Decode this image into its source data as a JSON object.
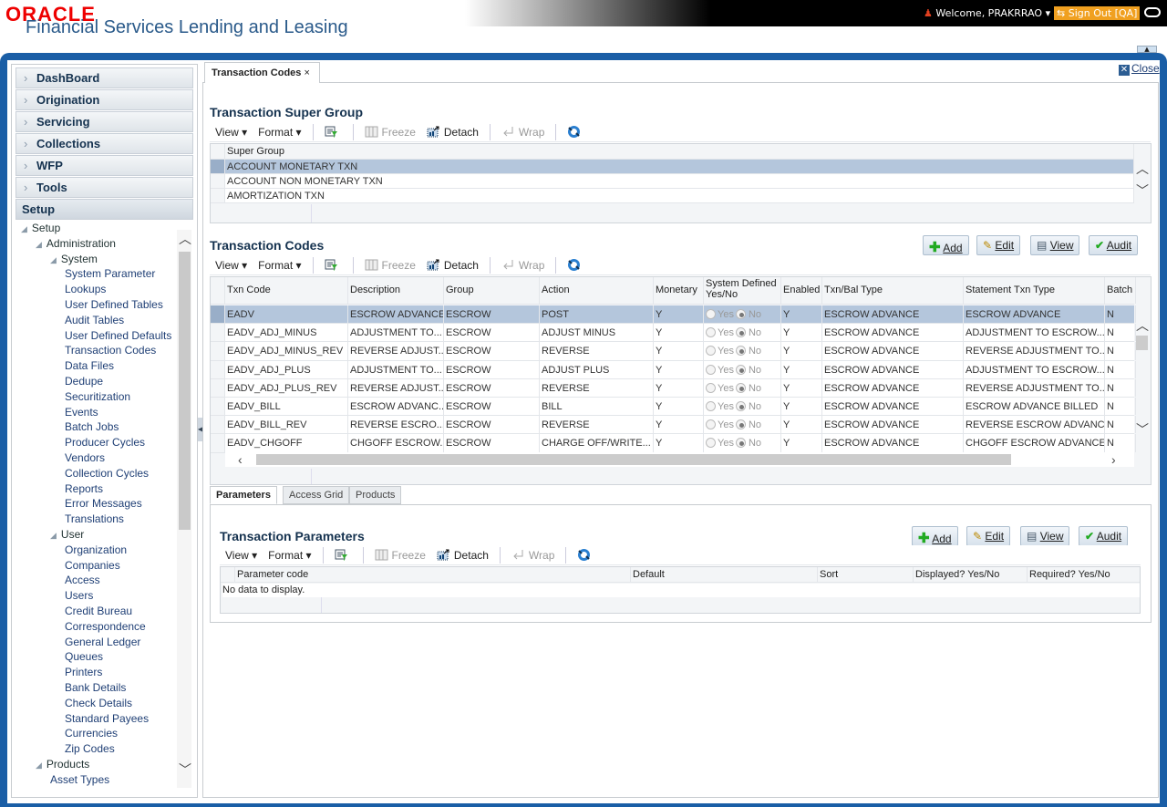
{
  "header": {
    "logo": "ORACLE",
    "app_title": "Financial Services Lending and Leasing",
    "welcome": "Welcome, PRAKRRAO ▾",
    "signout": "Sign Out [QA]"
  },
  "sidebar": {
    "accordion": [
      "DashBoard",
      "Origination",
      "Servicing",
      "Collections",
      "WFP",
      "Tools",
      "Setup"
    ],
    "tree": [
      {
        "label": "Setup",
        "level": 0,
        "node": true
      },
      {
        "label": "Administration",
        "level": 1,
        "node": true
      },
      {
        "label": "System",
        "level": 2,
        "node": true
      },
      {
        "label": "System Parameter",
        "level": 3
      },
      {
        "label": "Lookups",
        "level": 3
      },
      {
        "label": "User Defined Tables",
        "level": 3
      },
      {
        "label": "Audit Tables",
        "level": 3
      },
      {
        "label": "User Defined Defaults",
        "level": 3
      },
      {
        "label": "Transaction Codes",
        "level": 3
      },
      {
        "label": "Data Files",
        "level": 3
      },
      {
        "label": "Dedupe",
        "level": 3
      },
      {
        "label": "Securitization",
        "level": 3
      },
      {
        "label": "Events",
        "level": 3
      },
      {
        "label": "Batch Jobs",
        "level": 3
      },
      {
        "label": "Producer Cycles",
        "level": 3
      },
      {
        "label": "Vendors",
        "level": 3
      },
      {
        "label": "Collection Cycles",
        "level": 3
      },
      {
        "label": "Reports",
        "level": 3
      },
      {
        "label": "Error Messages",
        "level": 3
      },
      {
        "label": "Translations",
        "level": 3
      },
      {
        "label": "User",
        "level": 2,
        "node": true
      },
      {
        "label": "Organization",
        "level": 3
      },
      {
        "label": "Companies",
        "level": 3
      },
      {
        "label": "Access",
        "level": 3
      },
      {
        "label": "Users",
        "level": 3
      },
      {
        "label": "Credit Bureau",
        "level": 3
      },
      {
        "label": "Correspondence",
        "level": 3
      },
      {
        "label": "General Ledger",
        "level": 3
      },
      {
        "label": "Queues",
        "level": 3
      },
      {
        "label": "Printers",
        "level": 3
      },
      {
        "label": "Bank Details",
        "level": 3
      },
      {
        "label": "Check Details",
        "level": 3
      },
      {
        "label": "Standard Payees",
        "level": 3
      },
      {
        "label": "Currencies",
        "level": 3
      },
      {
        "label": "Zip Codes",
        "level": 3
      },
      {
        "label": "Products",
        "level": 1,
        "node": true
      },
      {
        "label": "Asset Types",
        "level": 2
      }
    ]
  },
  "main": {
    "tab": "Transaction Codes",
    "close": "Close",
    "toolbar": {
      "view": "View ▾",
      "format": "Format ▾",
      "freeze": "Freeze",
      "detach": "Detach",
      "wrap": "Wrap"
    },
    "super_group": {
      "title": "Transaction Super Group",
      "header": "Super Group",
      "rows": [
        "ACCOUNT MONETARY TXN",
        "ACCOUNT NON MONETARY TXN",
        "AMORTIZATION TXN"
      ]
    },
    "codes": {
      "title": "Transaction Codes",
      "buttons": {
        "add": "Add",
        "edit": "Edit",
        "view": "View",
        "audit": "Audit"
      },
      "columns": [
        "Txn Code",
        "Description",
        "Group",
        "Action",
        "Monetary",
        "System Defined Yes/No",
        "Enabled",
        "Txn/Bal Type",
        "Statement Txn Type",
        "Batch"
      ],
      "radio_yes": "Yes",
      "radio_no": "No",
      "rows": [
        [
          "EADV",
          "ESCROW ADVANCE",
          "ESCROW",
          "POST",
          "Y",
          "No",
          "Y",
          "ESCROW ADVANCE",
          "ESCROW ADVANCE",
          "N"
        ],
        [
          "EADV_ADJ_MINUS",
          "ADJUSTMENT TO...",
          "ESCROW",
          "ADJUST MINUS",
          "Y",
          "No",
          "Y",
          "ESCROW ADVANCE",
          "ADJUSTMENT TO ESCROW...",
          "N"
        ],
        [
          "EADV_ADJ_MINUS_REV",
          "REVERSE ADJUST...",
          "ESCROW",
          "REVERSE",
          "Y",
          "No",
          "Y",
          "ESCROW ADVANCE",
          "REVERSE ADJUSTMENT TO...",
          "N"
        ],
        [
          "EADV_ADJ_PLUS",
          "ADJUSTMENT TO...",
          "ESCROW",
          "ADJUST PLUS",
          "Y",
          "No",
          "Y",
          "ESCROW ADVANCE",
          "ADJUSTMENT TO ESCROW...",
          "N"
        ],
        [
          "EADV_ADJ_PLUS_REV",
          "REVERSE ADJUST...",
          "ESCROW",
          "REVERSE",
          "Y",
          "No",
          "Y",
          "ESCROW ADVANCE",
          "REVERSE ADJUSTMENT TO...",
          "N"
        ],
        [
          "EADV_BILL",
          "ESCROW ADVANC...",
          "ESCROW",
          "BILL",
          "Y",
          "No",
          "Y",
          "ESCROW ADVANCE",
          "ESCROW ADVANCE BILLED",
          "N"
        ],
        [
          "EADV_BILL_REV",
          "REVERSE ESCRO...",
          "ESCROW",
          "REVERSE",
          "Y",
          "No",
          "Y",
          "ESCROW ADVANCE",
          "REVERSE ESCROW ADVANC...",
          "N"
        ],
        [
          "EADV_CHGOFF",
          "CHGOFF ESCROW...",
          "ESCROW",
          "CHARGE OFF/WRITE...",
          "Y",
          "No",
          "Y",
          "ESCROW ADVANCE",
          "CHGOFF ESCROW ADVANCE",
          "N"
        ]
      ]
    },
    "subtabs": [
      "Parameters",
      "Access Grid",
      "Products"
    ],
    "params": {
      "title": "Transaction Parameters",
      "columns": [
        "Parameter code",
        "Default",
        "Sort",
        "Displayed? Yes/No",
        "Required? Yes/No"
      ],
      "empty": "No data to display."
    }
  }
}
